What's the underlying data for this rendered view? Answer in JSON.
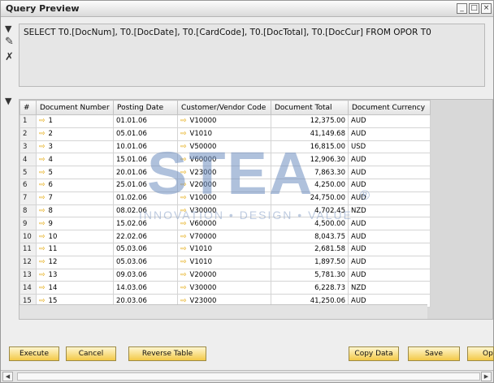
{
  "window": {
    "title": "Query Preview"
  },
  "sql": "SELECT T0.[DocNum], T0.[DocDate], T0.[CardCode], T0.[DocTotal], T0.[DocCur] FROM OPOR T0",
  "columns": [
    "#",
    "Document Number",
    "Posting Date",
    "Customer/Vendor Code",
    "Document Total",
    "Document Currency"
  ],
  "rows": [
    {
      "n": "1",
      "doc": "1",
      "date": "01.01.06",
      "code": "V10000",
      "total": "12,375.00",
      "cur": "AUD"
    },
    {
      "n": "2",
      "doc": "2",
      "date": "05.01.06",
      "code": "V1010",
      "total": "41,149.68",
      "cur": "AUD"
    },
    {
      "n": "3",
      "doc": "3",
      "date": "10.01.06",
      "code": "V50000",
      "total": "16,815.00",
      "cur": "USD"
    },
    {
      "n": "4",
      "doc": "4",
      "date": "15.01.06",
      "code": "V60000",
      "total": "12,906.30",
      "cur": "AUD"
    },
    {
      "n": "5",
      "doc": "5",
      "date": "20.01.06",
      "code": "V23000",
      "total": "7,863.30",
      "cur": "AUD"
    },
    {
      "n": "6",
      "doc": "6",
      "date": "25.01.06",
      "code": "V20000",
      "total": "4,250.00",
      "cur": "AUD"
    },
    {
      "n": "7",
      "doc": "7",
      "date": "01.02.06",
      "code": "V10000",
      "total": "24,750.00",
      "cur": "AUD"
    },
    {
      "n": "8",
      "doc": "8",
      "date": "08.02.06",
      "code": "V30000",
      "total": "4,702.45",
      "cur": "NZD"
    },
    {
      "n": "9",
      "doc": "9",
      "date": "15.02.06",
      "code": "V60000",
      "total": "4,500.00",
      "cur": "AUD"
    },
    {
      "n": "10",
      "doc": "10",
      "date": "22.02.06",
      "code": "V70000",
      "total": "8,043.75",
      "cur": "AUD"
    },
    {
      "n": "11",
      "doc": "11",
      "date": "05.03.06",
      "code": "V1010",
      "total": "2,681.58",
      "cur": "AUD"
    },
    {
      "n": "12",
      "doc": "12",
      "date": "05.03.06",
      "code": "V1010",
      "total": "1,897.50",
      "cur": "AUD"
    },
    {
      "n": "13",
      "doc": "13",
      "date": "09.03.06",
      "code": "V20000",
      "total": "5,781.30",
      "cur": "AUD"
    },
    {
      "n": "14",
      "doc": "14",
      "date": "14.03.06",
      "code": "V30000",
      "total": "6,228.73",
      "cur": "NZD"
    },
    {
      "n": "15",
      "doc": "15",
      "date": "20.03.06",
      "code": "V23000",
      "total": "41,250.06",
      "cur": "AUD"
    }
  ],
  "buttons": {
    "execute": "Execute",
    "cancel": "Cancel",
    "reverse": "Reverse Table",
    "copy": "Copy Data",
    "save": "Save",
    "open": "Op"
  },
  "watermark": {
    "logo": "STEA",
    "tagline": "INNOVATION • DESIGN • VALUE",
    "reg": "®"
  },
  "icons": [
    "pencil-icon",
    "wrench-icon",
    "arrow-link-icon"
  ],
  "colors": {
    "button_bg": "#f3c948",
    "arrow": "#e3a500",
    "header": "#e3e3e3"
  }
}
